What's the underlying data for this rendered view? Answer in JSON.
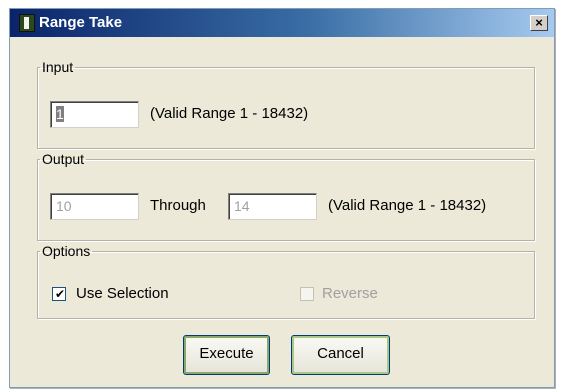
{
  "window": {
    "title": "Range Take",
    "close_label": "×"
  },
  "input_group": {
    "legend": "Input",
    "value": "1",
    "range_text": "(Valid Range 1 - 18432)"
  },
  "output_group": {
    "legend": "Output",
    "from_value": "10",
    "through_label": "Through",
    "to_value": "14",
    "range_text": "(Valid Range 1 - 18432)"
  },
  "options_group": {
    "legend": "Options",
    "use_selection": {
      "label": "Use Selection",
      "checked": true,
      "check_glyph": "✔"
    },
    "reverse": {
      "label": "Reverse",
      "checked": false,
      "disabled": true
    }
  },
  "buttons": {
    "execute": "Execute",
    "cancel": "Cancel"
  }
}
